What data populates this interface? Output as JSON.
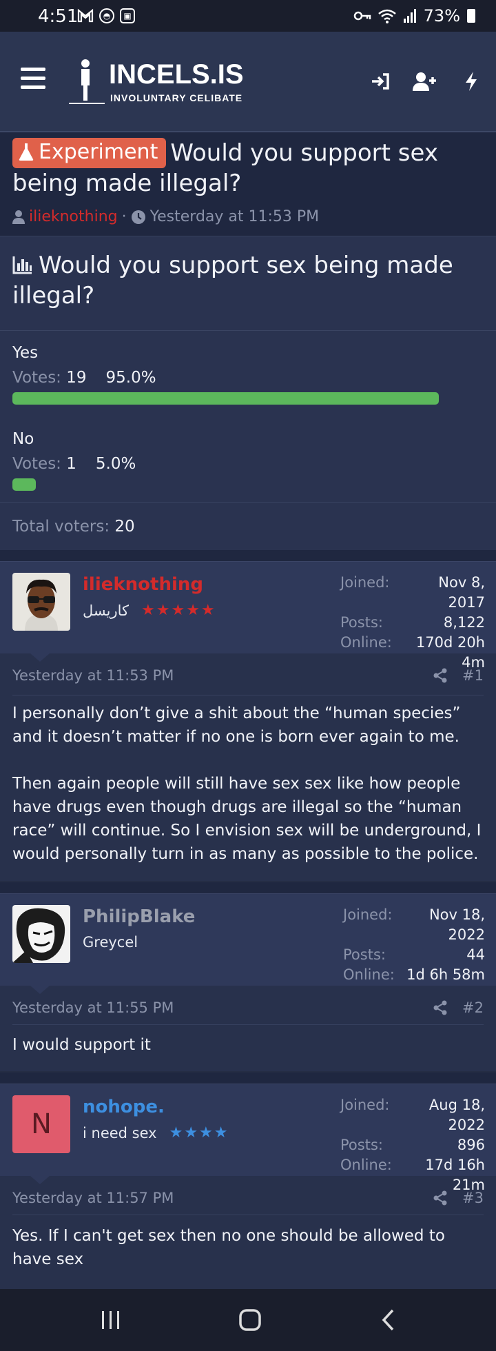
{
  "status_bar": {
    "time": "4:51",
    "battery": "73%"
  },
  "header": {
    "site_name": "INCELS.IS",
    "tagline": "INVOLUNTARY CELIBATE",
    "icons": [
      "menu-icon",
      "login-icon",
      "register-icon",
      "whats-new-icon"
    ]
  },
  "thread": {
    "prefix": "Experiment",
    "title": "Would you support sex being made illegal?",
    "author": "ilieknothing",
    "separator": "·",
    "date": "Yesterday at 11:53 PM"
  },
  "poll": {
    "question": "Would you support sex being made illegal?",
    "votes_label": "Votes:",
    "options": [
      {
        "label": "Yes",
        "votes": "19",
        "percent": "95.0%",
        "fraction": 0.95
      },
      {
        "label": "No",
        "votes": "1",
        "percent": "5.0%",
        "fraction": 0.05
      }
    ],
    "total_label": "Total voters:",
    "total": "20",
    "bar_color": "#5cb85c"
  },
  "stat_labels": {
    "joined": "Joined:",
    "posts": "Posts:",
    "online": "Online:"
  },
  "posts": [
    {
      "username": "ilieknothing",
      "username_color": "#d32b2b",
      "user_title": "كاريسل",
      "stars": "★★★★★",
      "stars_color": "#d32b2b",
      "joined": "Nov 8, 2017",
      "posts": "8,122",
      "online": "170d 20h 4m",
      "date": "Yesterday at 11:53 PM",
      "number": "#1",
      "body": [
        "I personally don’t give a shit about the “human species” and it doesn’t matter if no one is born ever again to me.",
        "Then again people will still have sex sex like how people have drugs even though drugs are illegal so the “human race” will continue. So I envision sex will be underground, I would personally turn in as many as possible to the police."
      ]
    },
    {
      "username": "PhilipBlake",
      "username_color": "#9a9fad",
      "user_title": "Greycel",
      "stars": "",
      "joined": "Nov 18, 2022",
      "posts": "44",
      "online": "1d 6h 58m",
      "date": "Yesterday at 11:55 PM",
      "number": "#2",
      "body": [
        "I would support it"
      ]
    },
    {
      "username": "nohope.",
      "username_color": "#3d8fe0",
      "user_title": "i need sex",
      "avatar_letter": "N",
      "stars": "★★★★",
      "stars_color": "#3d8fe0",
      "joined": "Aug 18, 2022",
      "posts": "896",
      "online": "17d 16h 21m",
      "date": "Yesterday at 11:57 PM",
      "number": "#3",
      "body": [
        "Yes. If I can't get sex then no one should be allowed to have sex"
      ]
    }
  ]
}
